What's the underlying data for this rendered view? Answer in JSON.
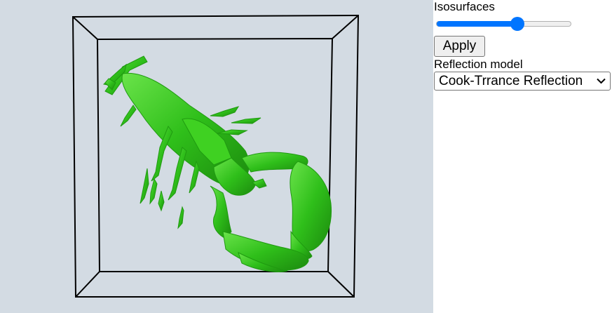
{
  "viewport": {
    "background": "#d3dbe3",
    "box_color": "#000000",
    "object_color": "#2fbf1a"
  },
  "controls": {
    "isosurfaces_label": "Isosurfaces",
    "slider_value": 0.6,
    "slider_accent": "#0075ff",
    "apply_label": "Apply",
    "reflection_label": "Reflection model",
    "reflection_value": "Cook-Trrance Reflection"
  }
}
